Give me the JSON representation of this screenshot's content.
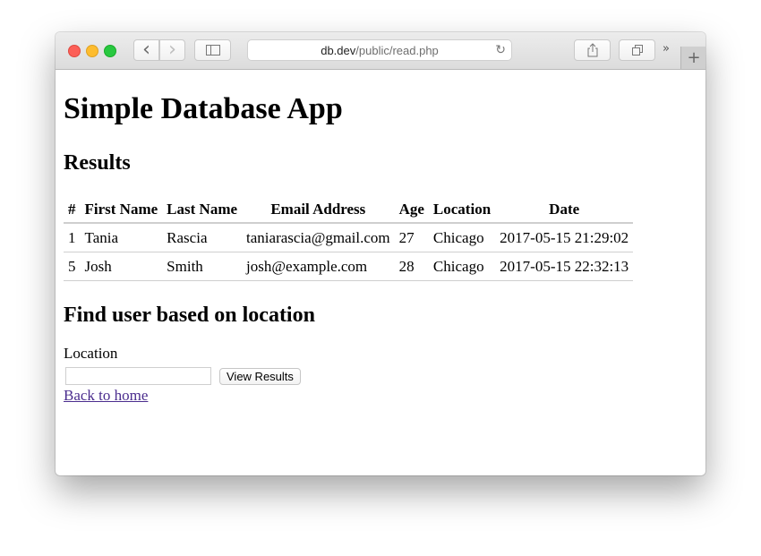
{
  "browser": {
    "url_domain": "db.dev",
    "url_path": "/public/read.php",
    "icons": {
      "back": "‹",
      "forward": "›",
      "sidebar": "▯",
      "reload": "↻",
      "share": "⇪",
      "tabs": "❐",
      "more": "»",
      "new_tab": "+"
    }
  },
  "page": {
    "title": "Simple Database App",
    "results_heading": "Results",
    "table": {
      "headers": [
        "#",
        "First Name",
        "Last Name",
        "Email Address",
        "Age",
        "Location",
        "Date"
      ],
      "rows": [
        [
          "1",
          "Tania",
          "Rascia",
          "taniarascia@gmail.com",
          "27",
          "Chicago",
          "2017-05-15 21:29:02"
        ],
        [
          "5",
          "Josh",
          "Smith",
          "josh@example.com",
          "28",
          "Chicago",
          "2017-05-15 22:32:13"
        ]
      ]
    },
    "find_heading": "Find user based on location",
    "form": {
      "location_label": "Location",
      "location_value": "",
      "submit_label": "View Results"
    },
    "back_link": "Back to home"
  }
}
